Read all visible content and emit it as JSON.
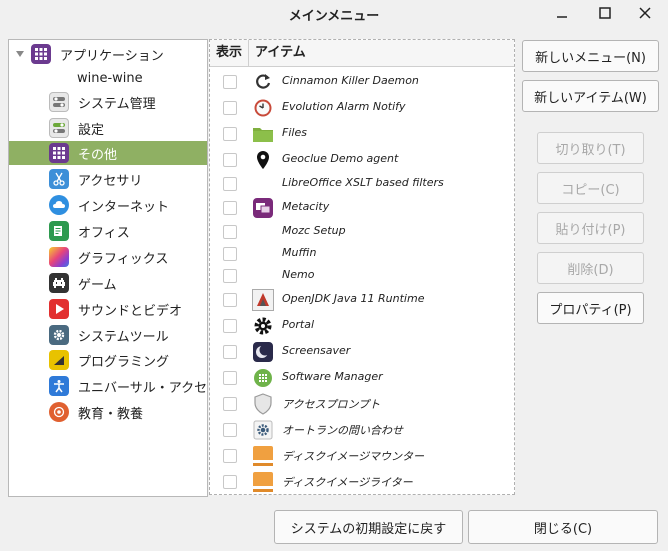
{
  "window": {
    "title": "メインメニュー"
  },
  "tree": {
    "items": [
      {
        "label": "アプリケーション",
        "icon": "app-grid-icon",
        "color": "#6b3a8f"
      },
      {
        "label": "wine-wine",
        "icon": "none"
      },
      {
        "label": "システム管理",
        "icon": "toggle-icon",
        "color": "#777777"
      },
      {
        "label": "設定",
        "icon": "settings-toggle-icon",
        "color": "#777777"
      },
      {
        "label": "その他",
        "icon": "grid-icon",
        "color": "#6b3a8f"
      },
      {
        "label": "アクセサリ",
        "icon": "scissors-icon",
        "color": "#3d8fd8"
      },
      {
        "label": "インターネット",
        "icon": "cloud-icon",
        "color": "#2f8fe0"
      },
      {
        "label": "オフィス",
        "icon": "office-icon",
        "color": "#2e9a4f"
      },
      {
        "label": "グラフィックス",
        "icon": "palette-icon",
        "color": "#e05a9a"
      },
      {
        "label": "ゲーム",
        "icon": "invader-icon",
        "color": "#333333"
      },
      {
        "label": "サウンドとビデオ",
        "icon": "play-icon",
        "color": "#e23030"
      },
      {
        "label": "システムツール",
        "icon": "gear-icon",
        "color": "#4a6a80"
      },
      {
        "label": "プログラミング",
        "icon": "programming-icon",
        "color": "#e8c200"
      },
      {
        "label": "ユニバーサル・アクセス",
        "icon": "accessibility-icon",
        "color": "#2f7ad8"
      },
      {
        "label": "教育・教養",
        "icon": "education-icon",
        "color": "#e06030"
      }
    ]
  },
  "list": {
    "header_show": "表示",
    "header_item": "アイテム",
    "rows": [
      {
        "label": "Cinnamon Killer Daemon",
        "icon": "refresh-icon"
      },
      {
        "label": "Evolution Alarm Notify",
        "icon": "alarm-clock-icon"
      },
      {
        "label": "Files",
        "icon": "folder-icon"
      },
      {
        "label": "Geoclue Demo agent",
        "icon": "location-pin-icon"
      },
      {
        "label": "LibreOffice XSLT based filters",
        "icon": "none"
      },
      {
        "label": "Metacity",
        "icon": "windows-icon"
      },
      {
        "label": "Mozc Setup",
        "icon": "none"
      },
      {
        "label": "Muffin",
        "icon": "none"
      },
      {
        "label": "Nemo",
        "icon": "none"
      },
      {
        "label": "OpenJDK Java 11 Runtime",
        "icon": "java-icon"
      },
      {
        "label": "Portal",
        "icon": "gear-icon"
      },
      {
        "label": "Screensaver",
        "icon": "moon-icon"
      },
      {
        "label": "Software Manager",
        "icon": "software-manager-icon"
      },
      {
        "label": "アクセスプロンプト",
        "icon": "shield-icon"
      },
      {
        "label": "オートランの問い合わせ",
        "icon": "gear-small-icon"
      },
      {
        "label": "ディスクイメージマウンター",
        "icon": "disk-image-icon"
      },
      {
        "label": "ディスクイメージライター",
        "icon": "disk-image-icon"
      }
    ]
  },
  "buttons": {
    "new_menu": "新しいメニュー(N)",
    "new_item": "新しいアイテム(W)",
    "cut": "切り取り(T)",
    "copy": "コピー(C)",
    "paste": "貼り付け(P)",
    "delete": "削除(D)",
    "properties": "プロパティ(P)",
    "reset": "システムの初期設定に戻す",
    "close": "閉じる(C)"
  }
}
